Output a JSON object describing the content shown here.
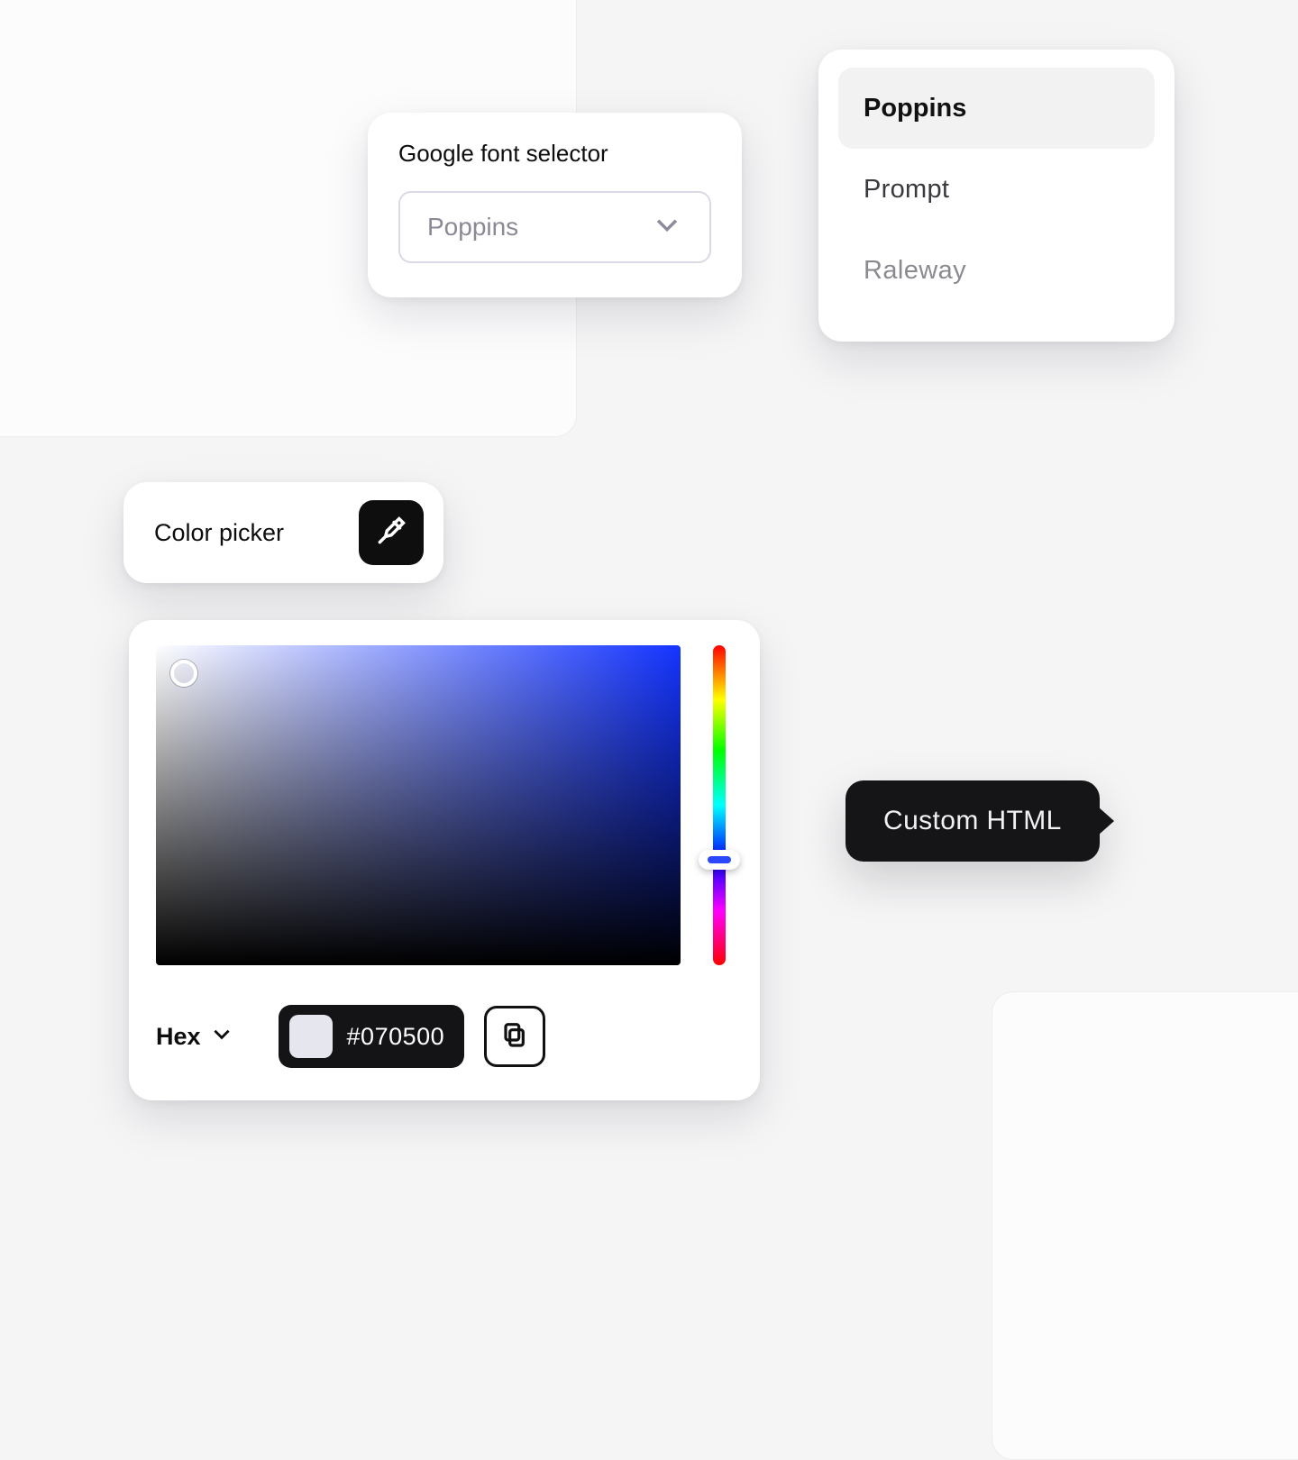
{
  "font_selector": {
    "title": "Google font selector",
    "selected": "Poppins",
    "options": [
      "Poppins",
      "Prompt",
      "Raleway"
    ]
  },
  "color_picker": {
    "label": "Color picker",
    "mode": "Hex",
    "hex_value": "#070500",
    "swatch_color": "#e6e6ef",
    "base_hue": "#1434ff"
  },
  "tooltip": {
    "custom_html": "Custom HTML"
  },
  "icons": {
    "eyedropper": "eyedropper-icon",
    "chevron_down": "chevron-down-icon",
    "copy": "copy-icon"
  }
}
